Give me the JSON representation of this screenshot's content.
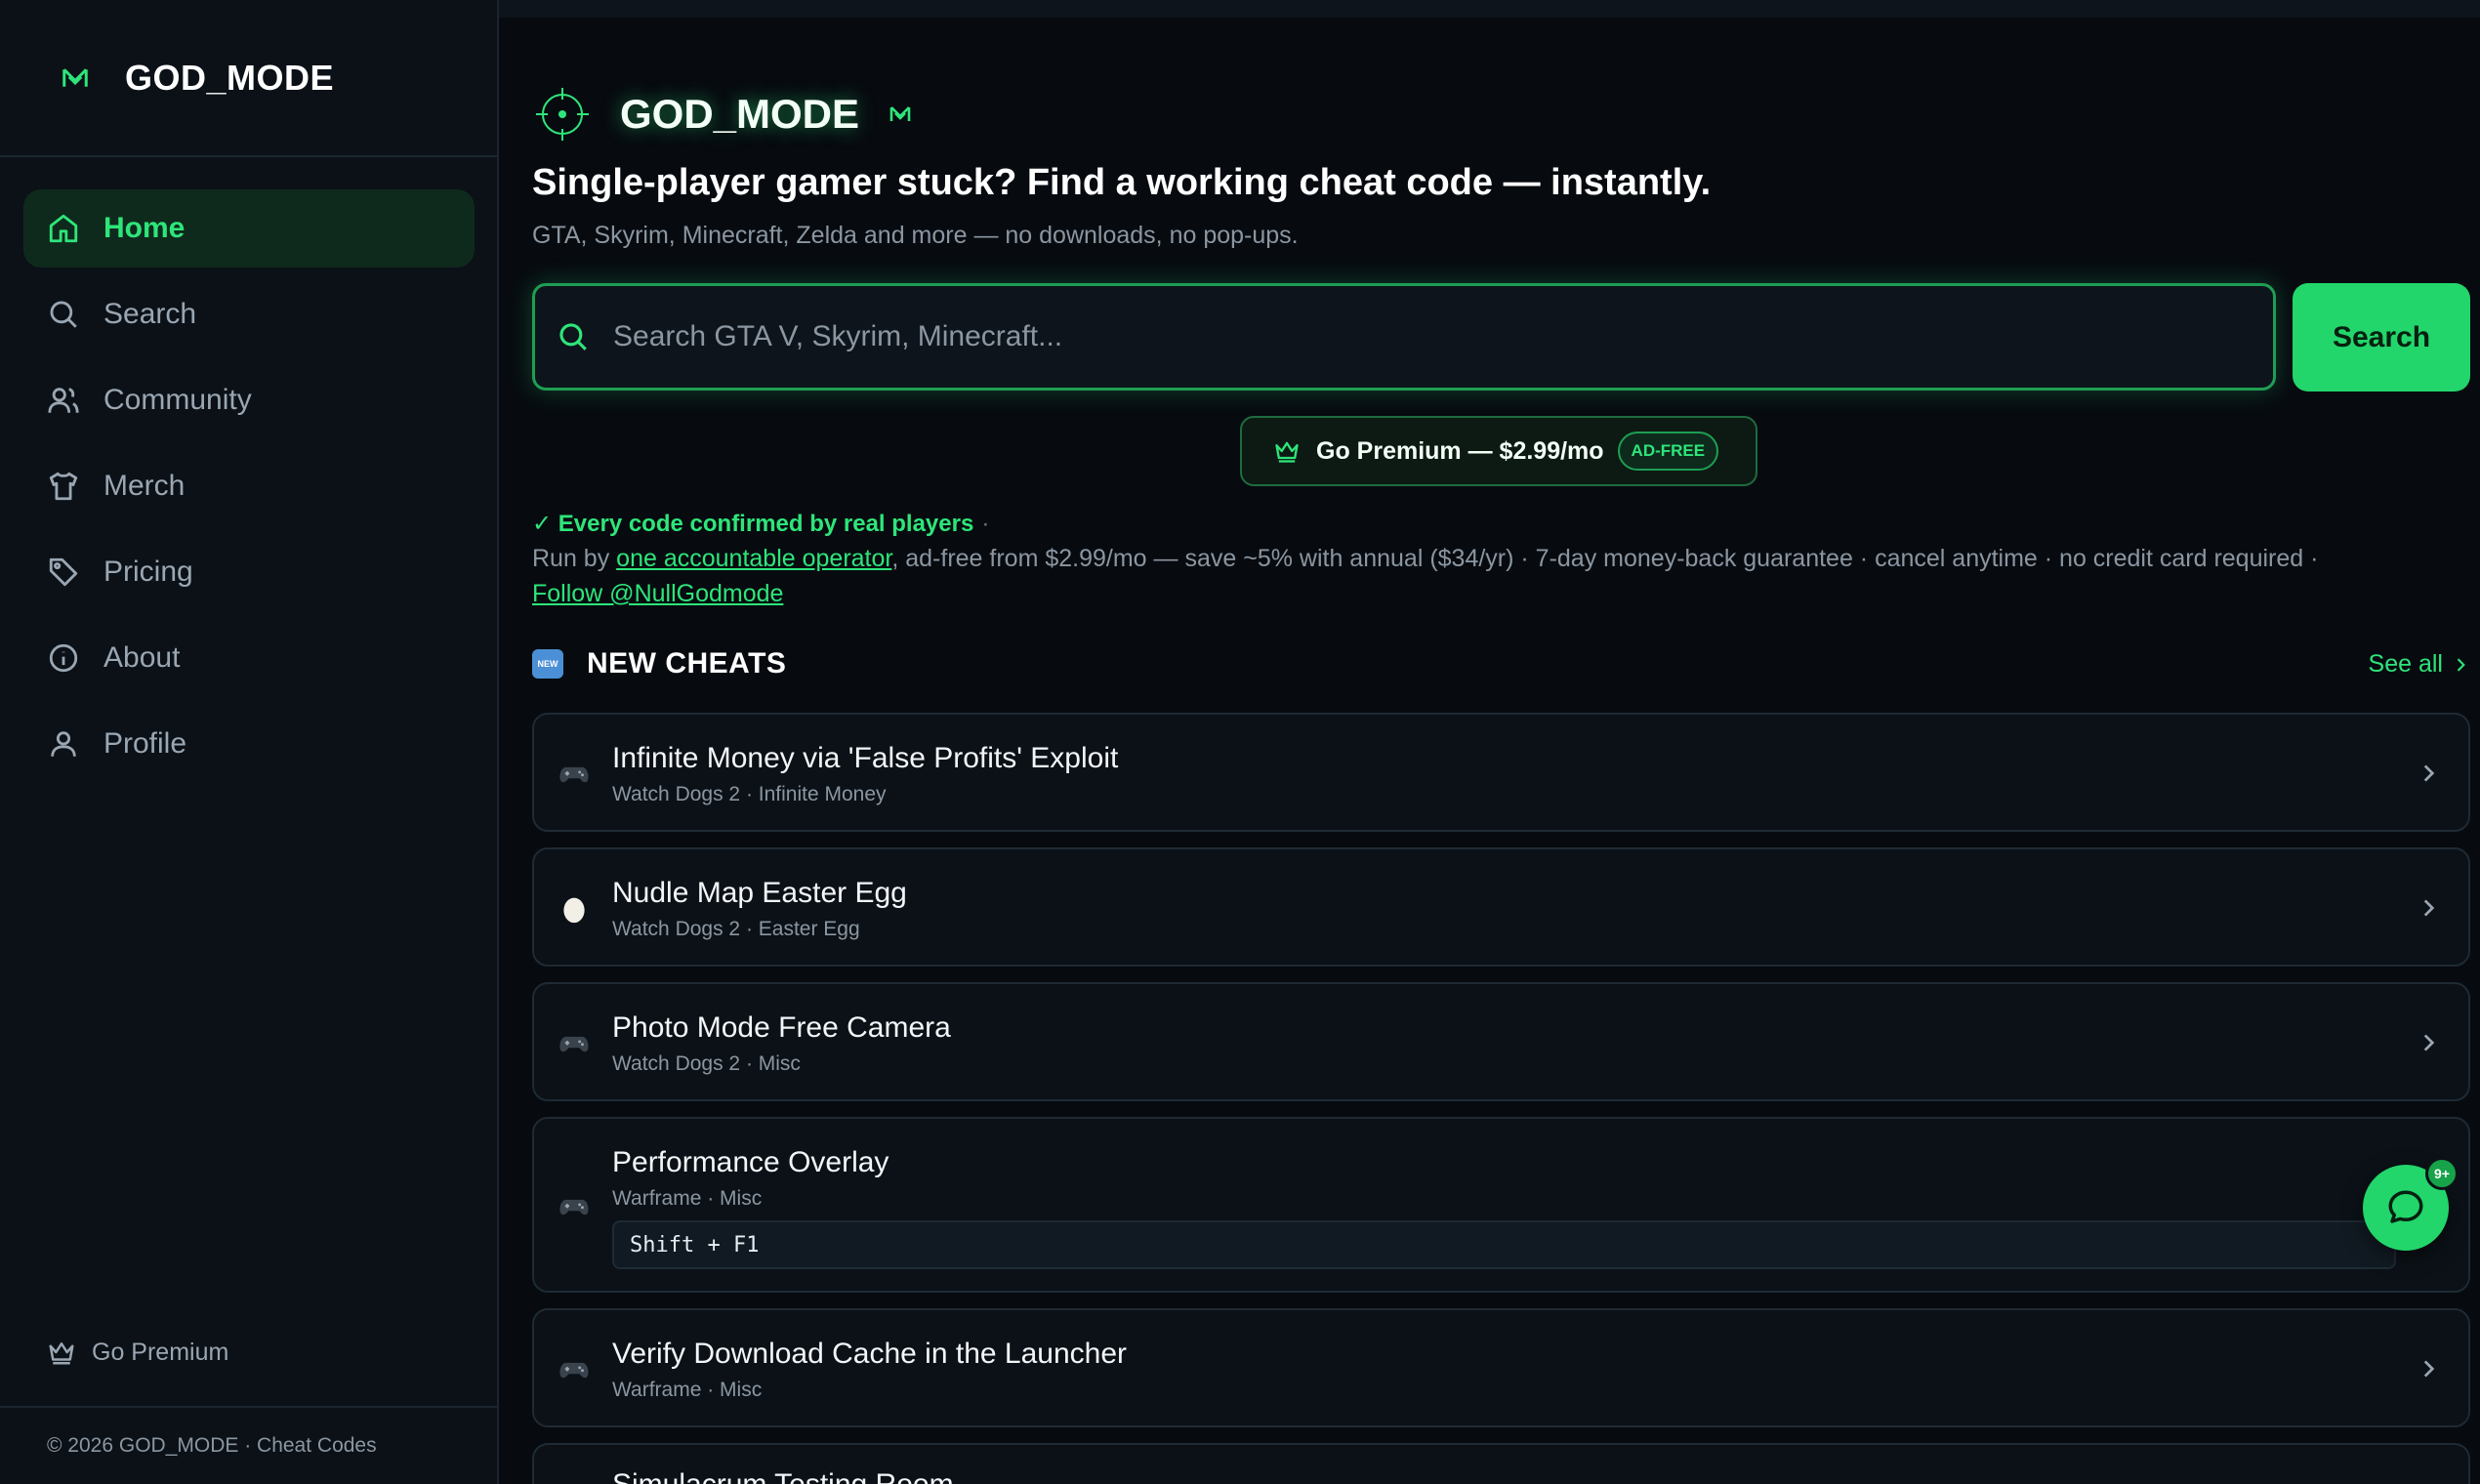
{
  "sidebar": {
    "brand": "GOD_MODE",
    "nav": [
      {
        "label": "Home",
        "icon": "home-icon",
        "active": true
      },
      {
        "label": "Search",
        "icon": "search-icon",
        "active": false
      },
      {
        "label": "Community",
        "icon": "users-icon",
        "active": false
      },
      {
        "label": "Merch",
        "icon": "shirt-icon",
        "active": false
      },
      {
        "label": "Pricing",
        "icon": "tag-icon",
        "active": false
      },
      {
        "label": "About",
        "icon": "info-icon",
        "active": false
      },
      {
        "label": "Profile",
        "icon": "user-icon",
        "active": false
      }
    ],
    "premium_label": "Go Premium",
    "footer": "© 2026 GOD_MODE · Cheat Codes"
  },
  "hero": {
    "brand": "GOD_MODE",
    "headline": "Single-player gamer stuck? Find a working cheat code — instantly.",
    "subline": "GTA, Skyrim, Minecraft, Zelda and more — no downloads, no pop-ups."
  },
  "search": {
    "placeholder": "Search GTA V, Skyrim, Minecraft...",
    "value": "",
    "button_label": "Search"
  },
  "premium": {
    "label": "Go Premium — $2.99/mo",
    "badge": "AD-FREE"
  },
  "info": {
    "verified": "✓ Every code confirmed by real players",
    "separator": "·",
    "run_by_prefix": "Run by ",
    "operator_link": "one accountable operator",
    "run_by_suffix": ", ad-free from $2.99/mo — save ~5% with annual ($34/yr) · 7-day money-back guarantee · cancel anytime · no credit card required  ·",
    "follow_link": "Follow @NullGodmode"
  },
  "new_cheats": {
    "badge": "NEW",
    "title": "NEW CHEATS",
    "see_all": "See all",
    "items": [
      {
        "title": "Infinite Money via 'False Profits' Exploit",
        "meta": "Watch Dogs 2 · Infinite Money",
        "icon": "gamepad-icon"
      },
      {
        "title": "Nudle Map Easter Egg",
        "meta": "Watch Dogs 2 · Easter Egg",
        "icon": "egg-icon"
      },
      {
        "title": "Photo Mode Free Camera",
        "meta": "Watch Dogs 2 · Misc",
        "icon": "gamepad-icon"
      },
      {
        "title": "Performance Overlay",
        "meta": "Warframe · Misc",
        "icon": "gamepad-icon",
        "code": "Shift + F1"
      },
      {
        "title": "Verify Download Cache in the Launcher",
        "meta": "Warframe · Misc",
        "icon": "gamepad-icon"
      },
      {
        "title": "Simulacrum Testing Room",
        "meta": "",
        "icon": "gamepad-icon"
      }
    ]
  },
  "chat": {
    "badge": "9+"
  },
  "colors": {
    "accent": "#22d66b",
    "background": "#070b10",
    "sidebar": "#0b1117"
  }
}
